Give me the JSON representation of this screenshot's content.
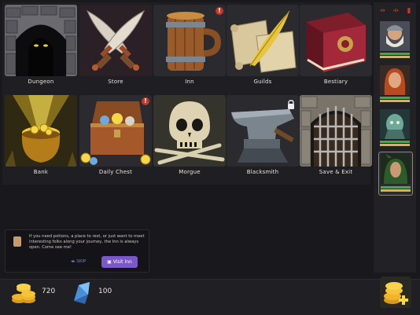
{
  "locations": [
    {
      "label": "Dungeon"
    },
    {
      "label": "Store"
    },
    {
      "label": "Inn",
      "badge": "!"
    },
    {
      "label": "Guilds"
    },
    {
      "label": "Bestiary"
    },
    {
      "label": "Bank"
    },
    {
      "label": "Daily Chest",
      "badge": "!"
    },
    {
      "label": "Morgue"
    },
    {
      "label": "Blacksmith",
      "locked": true
    },
    {
      "label": "Save & Exit"
    }
  ],
  "sidebar": {
    "top_icons": [
      "add-icon",
      "remove-icon",
      "trash-icon"
    ],
    "heroes": [
      {
        "name": "dwarf-hero",
        "hp": 1.0,
        "mp": 1.0
      },
      {
        "name": "red-haired-hero",
        "hp": 1.0,
        "mp": 1.0
      },
      {
        "name": "undead-hero",
        "hp": 1.0,
        "mp": 1.0
      },
      {
        "name": "elf-hero",
        "hp": 1.0,
        "mp": 1.0,
        "selected": true
      }
    ]
  },
  "tip": {
    "message": "If you need potions, a place to rest, or just want to meet interesting folks along your journey, the Inn is always open. Come see me!",
    "skip_label": "SKIP",
    "visit_label": "Visit Inn"
  },
  "currency": {
    "gold": "720",
    "gems": "100"
  },
  "colors": {
    "badge": "#c0392b",
    "button": "#7a58c7",
    "hp": "#3fae3a",
    "mp": "#d8b73a"
  }
}
